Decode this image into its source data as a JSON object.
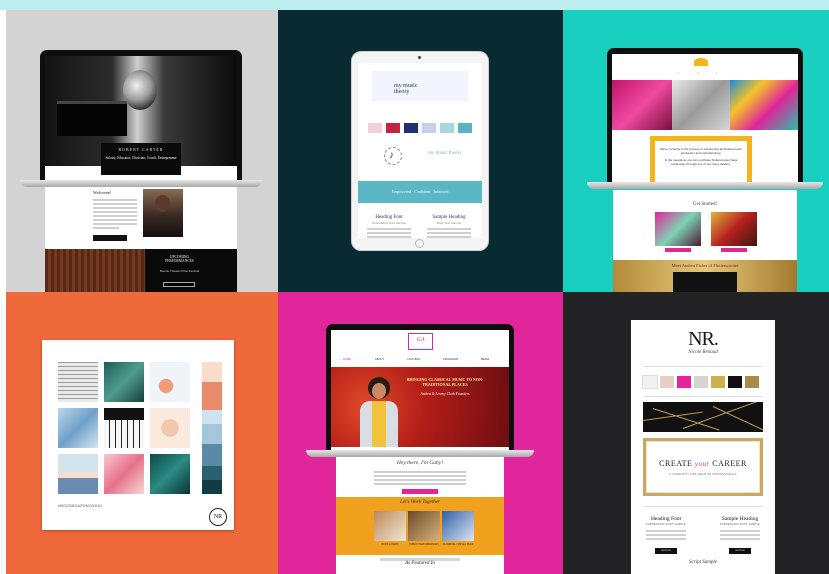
{
  "tile1": {
    "name_banner": "ROBERT CARTER",
    "tagline": "Soloist, Educator, Clinician, Coach, Entrepreneur",
    "welcome": "Welcome!",
    "upcoming": "UPCOMING PERFORMANCES",
    "venue": "Roosie Theater Price Festival",
    "colors": {
      "bg": "#d3d3d3"
    }
  },
  "tile2": {
    "logo_text": "my music theory",
    "logo_text2": "my music theory",
    "band_text": "Empowered · Confident · Informed",
    "heading_font": "Heading Font",
    "heading_font_sub": "Subheading Font Sample",
    "sample_heading": "Sample Heading",
    "sample_heading_sub": "Body Text Sample",
    "swatches": [
      "#f3d0dc",
      "#c32544",
      "#1f2f6f",
      "#c8cfee",
      "#a9d8de",
      "#59b5c2"
    ],
    "colors": {
      "bg": "#082a30"
    }
  },
  "tile3": {
    "message1": "We're currently in the process of transferring all Flutterscooter production and manufacturing.",
    "message2": "In the meantime you can purchase Flutterscooter bags exclusively through one of our many dealers.",
    "get_started": "Get Started!",
    "strip_text": "Meet Andrea Fisher of Flutterscooter",
    "colors": {
      "bg": "#18cfc0",
      "accent": "#e2278e",
      "gold": "#f2b51c"
    }
  },
  "tile4": {
    "caption": "#MOODBOARDMONDAY",
    "logo": "NR",
    "palette": [
      "#f9dccc",
      "#e98a6b",
      "#cfe2ef",
      "#a6c6dc",
      "#5b8aa6",
      "#2a6070",
      "#0f3d42"
    ],
    "colors": {
      "bg": "#ef6a3a"
    }
  },
  "tile5": {
    "logo": "GA",
    "nav": [
      "HOME",
      "ABOUT",
      "CULTURAL",
      "PROGRAMS",
      "MEDIA"
    ],
    "hero_title": "BRINGING CLASSICAL MUSIC TO NON-TRADITIONAL PLACES",
    "hero_sub": "Andrea & Jeremy Clark Founders",
    "hey": "Hey there, I'm Gaby!",
    "work_together": "Let's Work Together",
    "cards": [
      "BOOK & DEMO",
      "PUBLIC PERFORMANCES",
      "CLASSICAL FOR ALL PAGE"
    ],
    "featured": "As Featured In",
    "colors": {
      "bg": "#e0269a",
      "yellow": "#f0a11d"
    }
  },
  "tile6": {
    "logo": "NR.",
    "logo_sub": "Nicole Renaud",
    "headline_main1": "CREATE",
    "headline_script": "your",
    "headline_main2": "CAREER",
    "headline_sub": "A COMMUNITY FOR CREATIVE PROFESSIONALS",
    "heading_font": "Heading Font",
    "heading_sub": "SUBHEADING FONT SAMPLE",
    "sample_heading": "Sample Heading",
    "sample_sub": "SUBHEADING FONT SAMPLE",
    "button_label": "BUTTON",
    "button_label2": "BUTTON",
    "signature": "Script Sample",
    "swatches": [
      "#f4f0ee",
      "#e8cfc6",
      "#e7259a",
      "#d9d3cf",
      "#c9b14e",
      "#111111",
      "#a88a4a"
    ],
    "colors": {
      "bg": "#232326"
    }
  }
}
